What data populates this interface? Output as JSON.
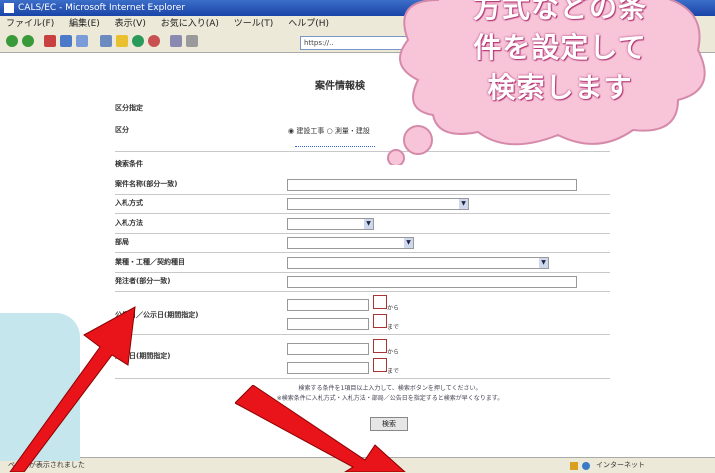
{
  "window": {
    "title": "CALS/EC - Microsoft Internet Explorer"
  },
  "menu": [
    "ファイル(F)",
    "編集(E)",
    "表示(V)",
    "お気に入り(A)",
    "ツール(T)",
    "ヘルプ(H)"
  ],
  "address": "https://..",
  "page": {
    "heading": "案件情報検",
    "section_category": "区分指定",
    "category_label": "区分",
    "radio_options": [
      "建設工事",
      "測量・建設"
    ],
    "section_search": "検索条件",
    "fields": [
      {
        "label": "案件名称(部分一致)"
      },
      {
        "label": "入札方式"
      },
      {
        "label": "入札方法"
      },
      {
        "label": "部局"
      },
      {
        "label": "業種・工種／契約種目"
      },
      {
        "label": "発注者(部分一致)"
      },
      {
        "label": "公告日／公示日(期間指定)"
      },
      {
        "label": "入札日(期間指定)"
      }
    ],
    "date_suffix_from": "から",
    "date_suffix_to": "まで",
    "note_line1": "検索する条件を1項目以上入力して、検索ボタンを押してください。",
    "note_line2": "※検索条件に入札方式・入札方法・部局／公告日を指定すると検索が早くなります。",
    "search_button": "検索"
  },
  "status": {
    "left": "ページが表示されました",
    "right": "インターネット"
  },
  "callout": {
    "line1": "方式などの条",
    "line2": "件を設定して",
    "line3": "検索します"
  },
  "colors": {
    "bubble": "#f7c4d8",
    "arrow": "#e8141a",
    "leftbox": "#c6e6ee"
  }
}
